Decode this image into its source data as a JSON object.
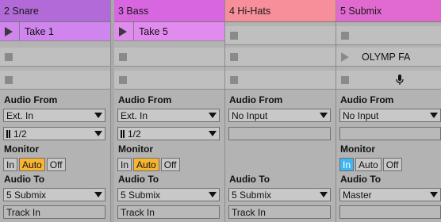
{
  "tracks": [
    {
      "name": "2 Snare",
      "header_color": "#b26ad8",
      "clip_color": "#cf85ed",
      "slots": [
        {
          "type": "clip",
          "label": "Take 1"
        },
        {
          "type": "stop"
        },
        {
          "type": "stop"
        }
      ],
      "audio_from_label": "Audio From",
      "audio_from_value": "Ext. In",
      "channel_value": "1/2",
      "monitor_label": "Monitor",
      "monitor": {
        "in": "In",
        "auto": "Auto",
        "off": "Off",
        "active": "auto"
      },
      "audio_to_label": "Audio To",
      "audio_to_value": "5 Submix",
      "output_channel": "Track In"
    },
    {
      "name": "3 Bass",
      "header_color": "#d866e0",
      "clip_color": "#e18bef",
      "slots": [
        {
          "type": "clip",
          "label": "Take 5"
        },
        {
          "type": "stop"
        },
        {
          "type": "stop"
        }
      ],
      "audio_from_label": "Audio From",
      "audio_from_value": "Ext. In",
      "channel_value": "1/2",
      "monitor_label": "Monitor",
      "monitor": {
        "in": "In",
        "auto": "Auto",
        "off": "Off",
        "active": "auto"
      },
      "audio_to_label": "Audio To",
      "audio_to_value": "5 Submix",
      "output_channel": "Track In"
    },
    {
      "name": "4 Hi-Hats",
      "header_color": "#f68f9a",
      "clip_color": "#f68f9a",
      "slots": [
        {
          "type": "stop"
        },
        {
          "type": "stop"
        },
        {
          "type": "stop"
        }
      ],
      "audio_from_label": "Audio From",
      "audio_from_value": "No Input",
      "channel_value": "",
      "monitor_label": "",
      "monitor": null,
      "audio_to_label": "Audio To",
      "audio_to_value": "5 Submix",
      "output_channel": "Track In"
    },
    {
      "name": "5 Submix",
      "header_color": "#e06acf",
      "clip_color": "#bdbdbd",
      "slots": [
        {
          "type": "stop"
        },
        {
          "type": "group",
          "label": "OLYMP FA"
        },
        {
          "type": "record",
          "icon": "microphone-icon"
        }
      ],
      "audio_from_label": "Audio From",
      "audio_from_value": "No Input",
      "channel_value": "",
      "monitor_label": "Monitor",
      "monitor": {
        "in": "In",
        "auto": "Auto",
        "off": "Off",
        "active": "in"
      },
      "audio_to_label": "Audio To",
      "audio_to_value": "Master",
      "output_channel": ""
    }
  ]
}
